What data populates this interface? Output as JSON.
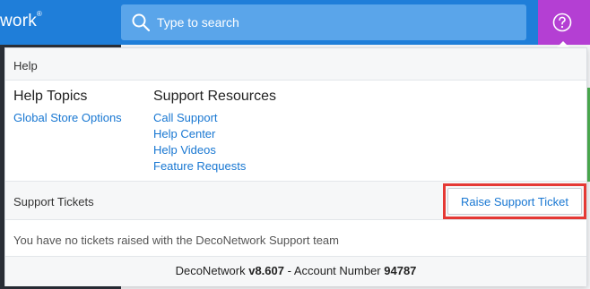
{
  "app": {
    "brand_fragment": "work",
    "brand_mark": "®"
  },
  "search": {
    "placeholder": "Type to search"
  },
  "help_panel": {
    "title": "Help",
    "help_topics": {
      "heading": "Help Topics",
      "links": [
        "Global Store Options"
      ]
    },
    "support_resources": {
      "heading": "Support Resources",
      "links": [
        "Call Support",
        "Help Center",
        "Help Videos",
        "Feature Requests"
      ]
    },
    "support_tickets": {
      "label": "Support Tickets",
      "raise_button": "Raise Support Ticket",
      "empty_message": "You have no tickets raised with the DecoNetwork Support team"
    },
    "footer": {
      "product": "DecoNetwork",
      "version": "v8.607",
      "separator": " - Account Number ",
      "account_number": "94787"
    }
  },
  "colors": {
    "topbar": "#1f7ed9",
    "help_button": "#b43fd3",
    "link": "#1877d2",
    "highlight": "#e53935"
  }
}
